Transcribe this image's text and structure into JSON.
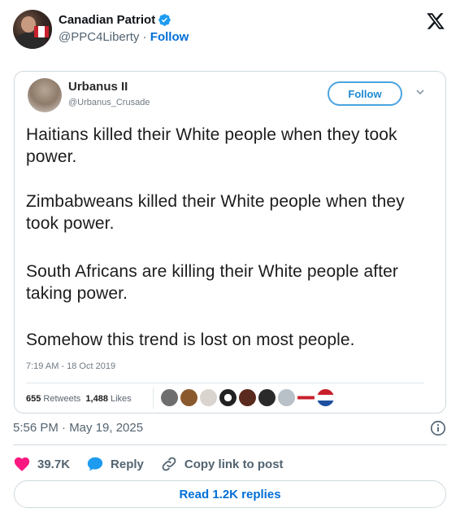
{
  "author": {
    "display_name": "Canadian Patriot",
    "handle": "@PPC4Liberty",
    "separator": "·",
    "follow_label": "Follow",
    "verified": true
  },
  "embedded_tweet": {
    "name": "Urbanus II",
    "handle": "@Urbanus_Crusade",
    "follow_label": "Follow",
    "paragraphs": [
      "Haitians killed their White people when they took power.",
      "Zimbabweans killed their White people when they took power.",
      "South Africans are killing their White people after taking power.",
      "Somehow this trend is lost on most people."
    ],
    "timestamp": "7:19 AM - 18 Oct 2019",
    "retweets_count": "655",
    "retweets_label": "Retweets",
    "likes_count": "1,488",
    "likes_label": "Likes"
  },
  "post": {
    "timestamp": "5:56 PM · May 19, 2025"
  },
  "actions": {
    "likes_count": "39.7K",
    "reply_label": "Reply",
    "copy_link_label": "Copy link to post"
  },
  "read_replies_label": "Read 1.2K replies",
  "colors": {
    "link_blue": "#006fd6",
    "verified_blue": "#1d9bf0",
    "like_pink": "#f91880",
    "secondary_text": "#536471"
  }
}
